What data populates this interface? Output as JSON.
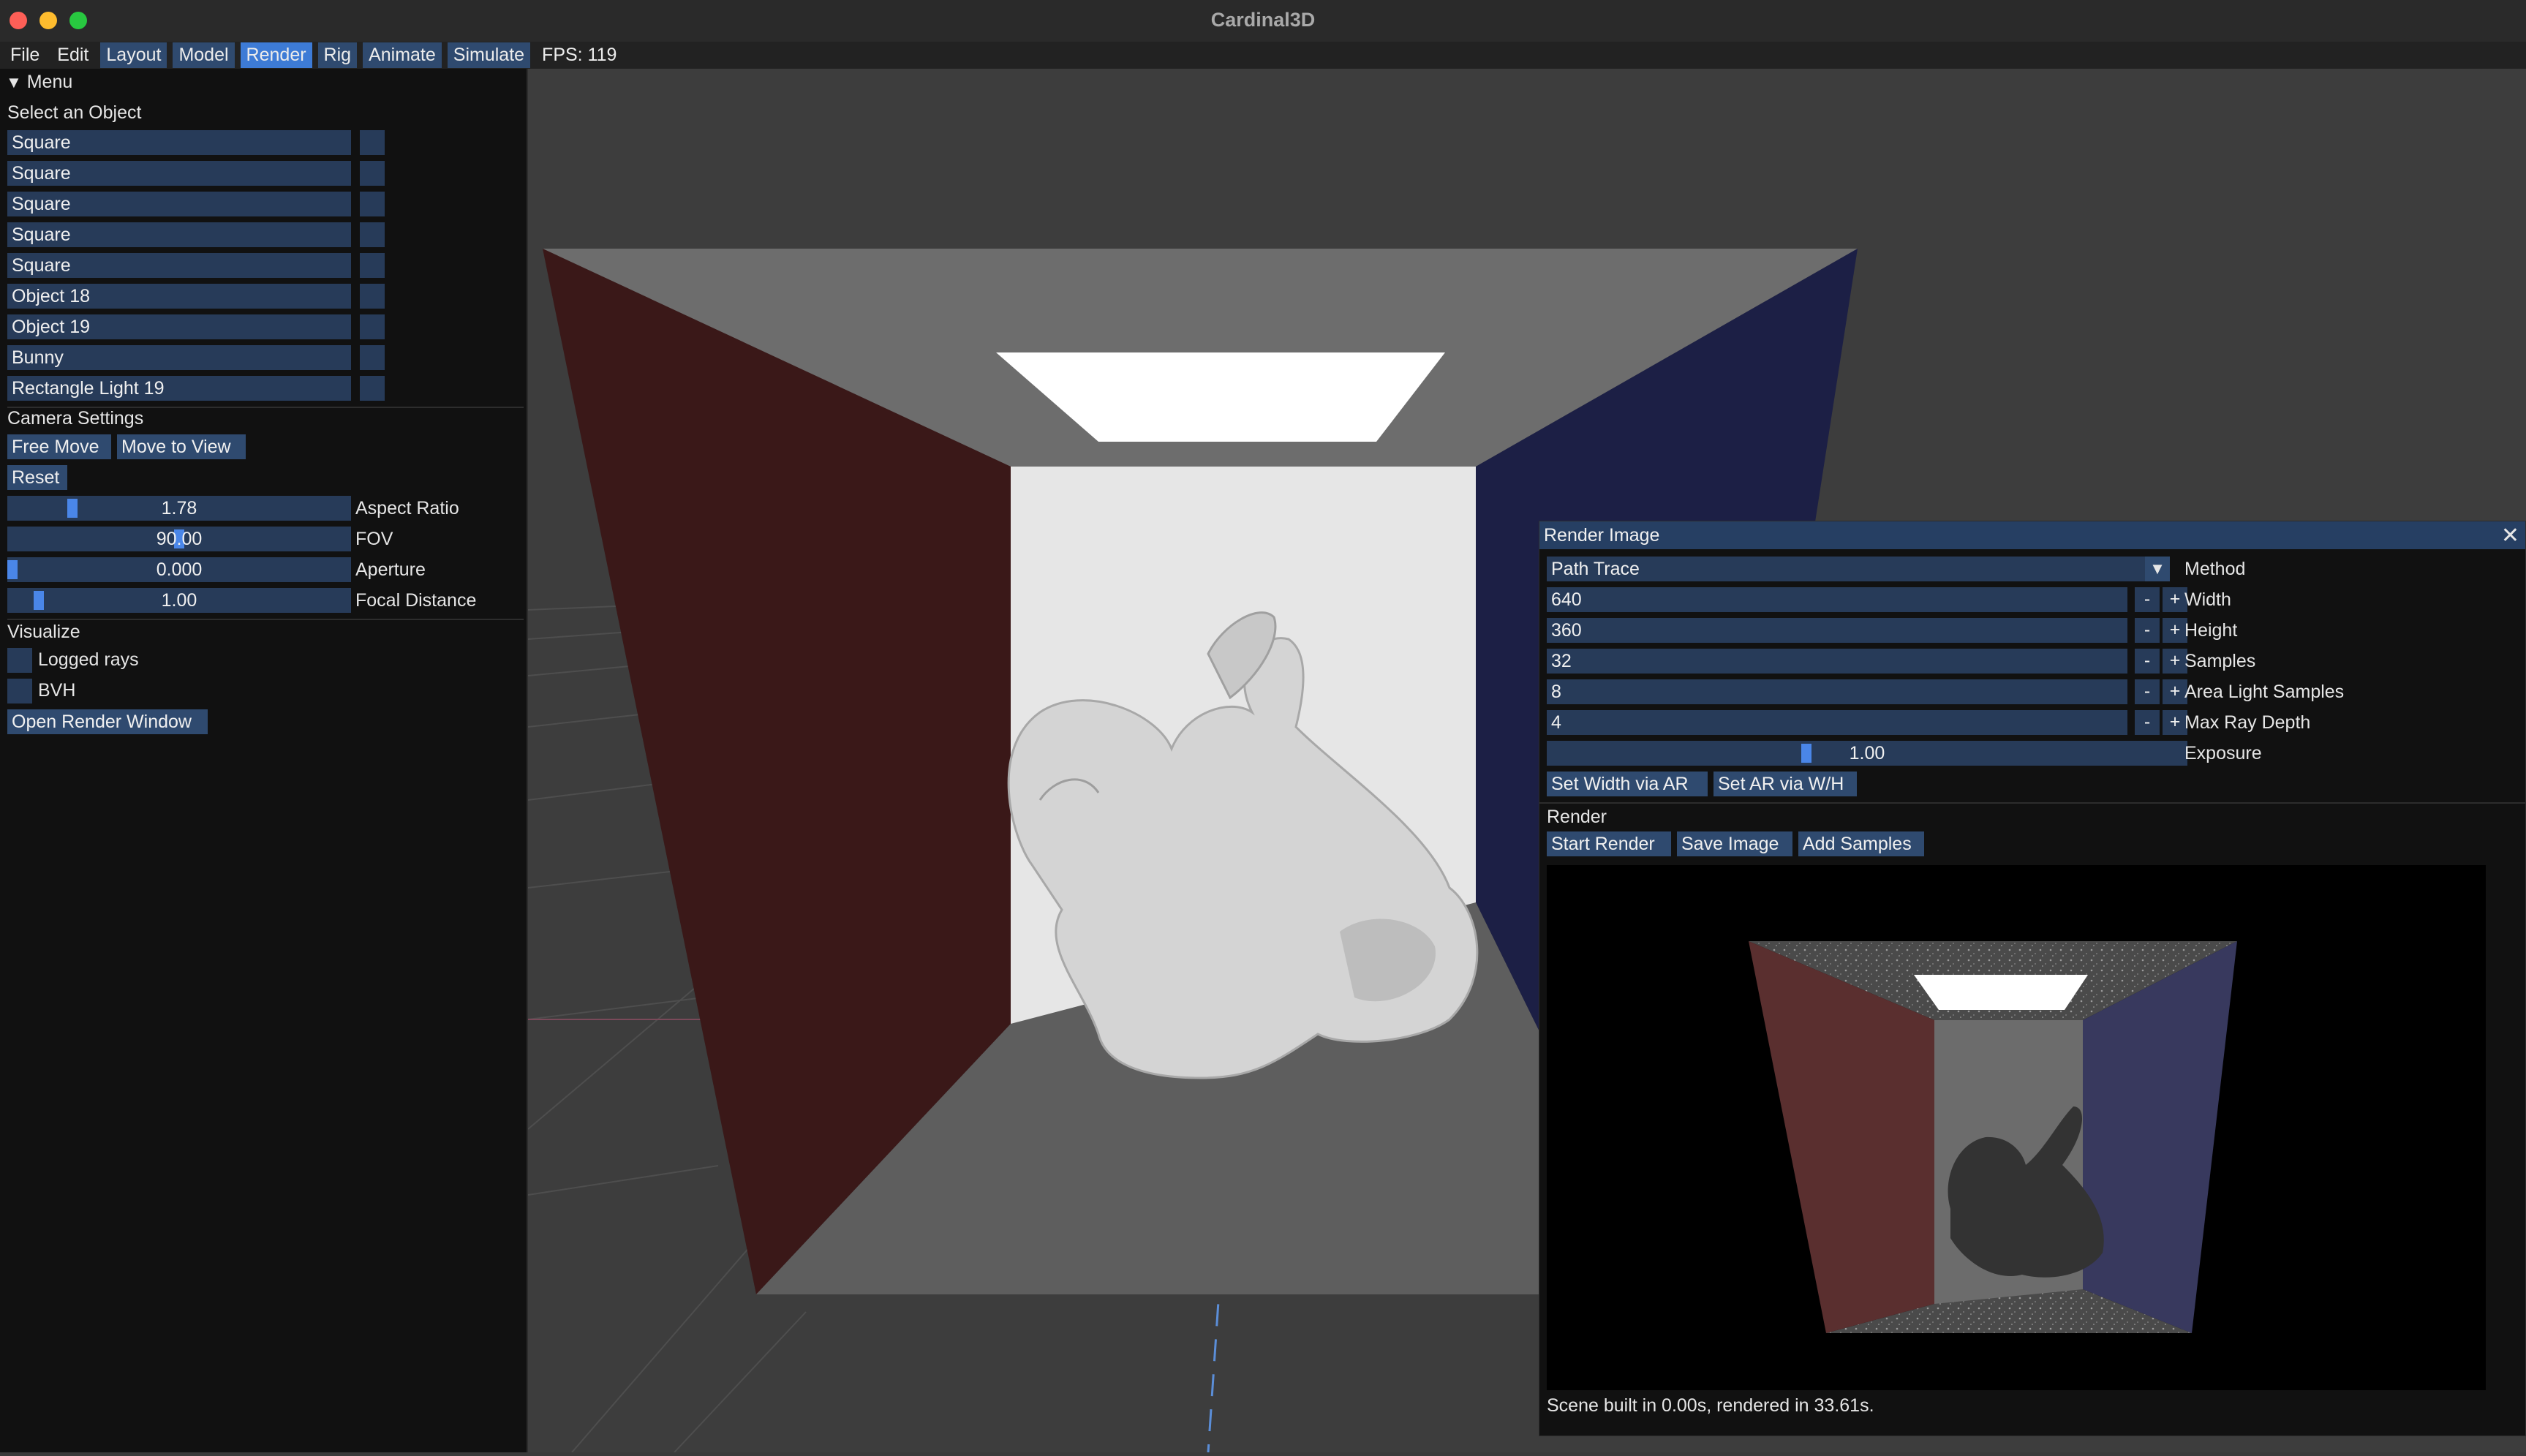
{
  "window": {
    "title": "Cardinal3D"
  },
  "menubar": {
    "file": "File",
    "edit": "Edit",
    "modes": [
      "Layout",
      "Model",
      "Render",
      "Rig",
      "Animate",
      "Simulate"
    ],
    "active_mode": "Render",
    "fps": "FPS: 119"
  },
  "left": {
    "menu_header": "Menu",
    "select_title": "Select an Object",
    "objects": [
      "Square",
      "Square",
      "Square",
      "Square",
      "Square",
      "Object 18",
      "Object 19",
      "Bunny",
      "Rectangle Light 19"
    ],
    "camera_title": "Camera Settings",
    "free_move": "Free Move",
    "move_to_view": "Move to View",
    "reset": "Reset",
    "sliders": [
      {
        "value": "1.78",
        "label": "Aspect Ratio",
        "fraction": 0.18
      },
      {
        "value": "90.00",
        "label": "FOV",
        "fraction": 0.5
      },
      {
        "value": "0.000",
        "label": "Aperture",
        "fraction": 0.0
      },
      {
        "value": "1.00",
        "label": "Focal Distance",
        "fraction": 0.08
      }
    ],
    "visualize_title": "Visualize",
    "logged_rays": "Logged rays",
    "bvh": "BVH",
    "open_render": "Open Render Window"
  },
  "render": {
    "title": "Render Image",
    "method_value": "Path Trace",
    "method_label": "Method",
    "fields": [
      {
        "value": "640",
        "label": "Width"
      },
      {
        "value": "360",
        "label": "Height"
      },
      {
        "value": "32",
        "label": "Samples"
      },
      {
        "value": "8",
        "label": "Area Light Samples"
      },
      {
        "value": "4",
        "label": "Max Ray Depth"
      }
    ],
    "exposure_value": "1.00",
    "exposure_label": "Exposure",
    "set_width": "Set Width via AR",
    "set_ar": "Set AR via W/H",
    "render_header": "Render",
    "start_render": "Start Render",
    "save_image": "Save Image",
    "add_samples": "Add Samples",
    "status": "Scene built in 0.00s, rendered in 33.61s."
  },
  "icons": {
    "menu_arrow": "triangle-down-icon",
    "dropdown_arrow": "triangle-down-icon",
    "close": "close-icon"
  },
  "colors": {
    "accent": "#3d7bd6",
    "button": "#2f4a6f",
    "field": "#273b59",
    "red_wall": "#3a1818",
    "blue_wall": "#1c1f45"
  }
}
